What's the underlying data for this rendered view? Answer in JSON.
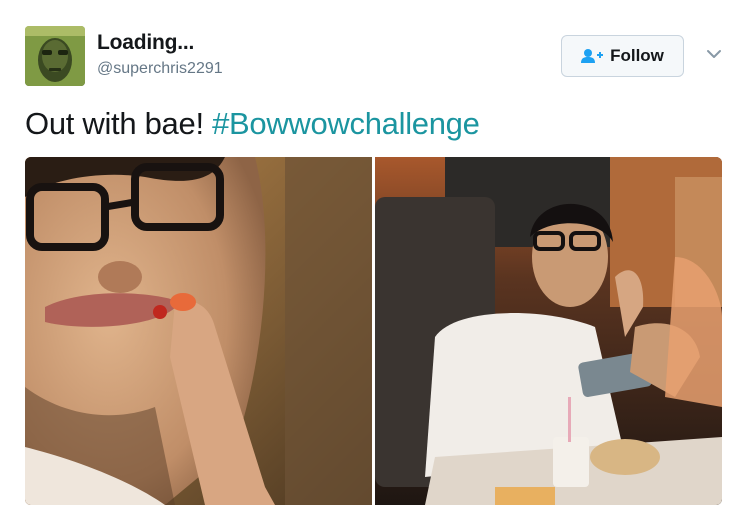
{
  "author": {
    "name": "Loading...",
    "handle": "@superchris2291",
    "avatar_icon": "profile-photo"
  },
  "follow_button": {
    "label": "Follow",
    "icon": "add-user-icon",
    "accent": "#1da1f2"
  },
  "menu": {
    "icon": "chevron-down-icon"
  },
  "tweet": {
    "text": "Out with bae! ",
    "hashtag": "#Bowwowchallenge",
    "hashtag_color": "#1b95a0"
  },
  "media": {
    "photos": [
      {
        "name": "photo-closeup"
      },
      {
        "name": "photo-restaurant"
      }
    ]
  }
}
